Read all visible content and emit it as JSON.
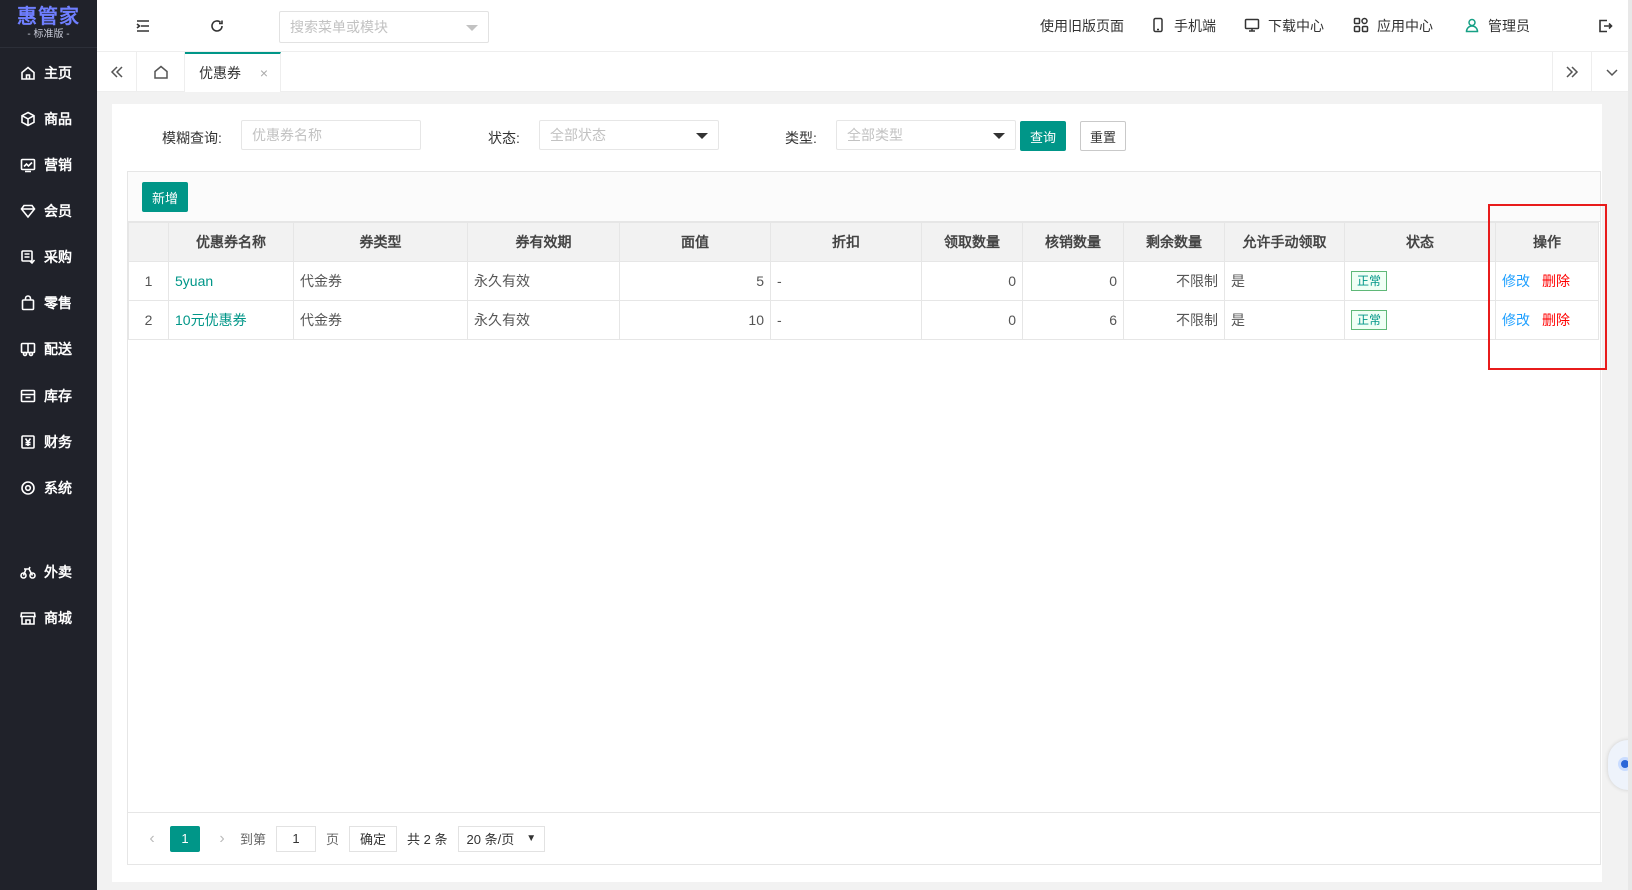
{
  "brand": {
    "title": "惠管家",
    "subtitle": "- 标准版 -"
  },
  "sidebar": {
    "items": [
      {
        "label": "主页",
        "icon": "home-icon"
      },
      {
        "label": "商品",
        "icon": "box-icon"
      },
      {
        "label": "营销",
        "icon": "chart-icon"
      },
      {
        "label": "会员",
        "icon": "diamond-icon"
      },
      {
        "label": "采购",
        "icon": "purchase-icon"
      },
      {
        "label": "零售",
        "icon": "bag-icon"
      },
      {
        "label": "配送",
        "icon": "truck-icon"
      },
      {
        "label": "库存",
        "icon": "inventory-icon"
      },
      {
        "label": "财务",
        "icon": "yen-icon"
      },
      {
        "label": "系统",
        "icon": "settings-icon"
      },
      {
        "label": "外卖",
        "icon": "bike-icon"
      },
      {
        "label": "商城",
        "icon": "store-icon"
      }
    ]
  },
  "header": {
    "search_placeholder": "搜索菜单或模块",
    "links": {
      "old_version": "使用旧版页面",
      "mobile": "手机端",
      "download": "下载中心",
      "apps": "应用中心",
      "user": "管理员"
    }
  },
  "tabs": {
    "active_label": "优惠券",
    "close": "×"
  },
  "filters": {
    "fuzzy_label": "模糊查询:",
    "fuzzy_placeholder": "优惠券名称",
    "status_label": "状态:",
    "status_value": "全部状态",
    "type_label": "类型:",
    "type_value": "全部类型",
    "query_button": "查询",
    "reset_button": "重置"
  },
  "toolbar": {
    "add_button": "新增"
  },
  "table": {
    "columns": [
      "",
      "优惠券名称",
      "券类型",
      "券有效期",
      "面值",
      "折扣",
      "领取数量",
      "核销数量",
      "剩余数量",
      "允许手动领取",
      "状态",
      "操作"
    ],
    "rows": [
      {
        "index": "1",
        "name": "5yuan",
        "type": "代金券",
        "validity": "永久有效",
        "value": "5",
        "discount": "-",
        "received": "0",
        "used": "0",
        "remaining": "不限制",
        "manual": "是",
        "status": "正常",
        "edit": "修改",
        "delete": "删除"
      },
      {
        "index": "2",
        "name": "10元优惠券",
        "type": "代金券",
        "validity": "永久有效",
        "value": "10",
        "discount": "-",
        "received": "0",
        "used": "6",
        "remaining": "不限制",
        "manual": "是",
        "status": "正常",
        "edit": "修改",
        "delete": "删除"
      }
    ]
  },
  "pager": {
    "current": "1",
    "goto_label": "到第",
    "goto_value": "1",
    "page_unit": "页",
    "confirm": "确定",
    "total": "共 2 条",
    "page_size": "20 条/页"
  },
  "colors": {
    "sidebar_bg": "#20222a",
    "accent": "#009688",
    "link_blue": "#1e9fff",
    "danger": "#ff0000",
    "highlight": "#e81b1b"
  }
}
